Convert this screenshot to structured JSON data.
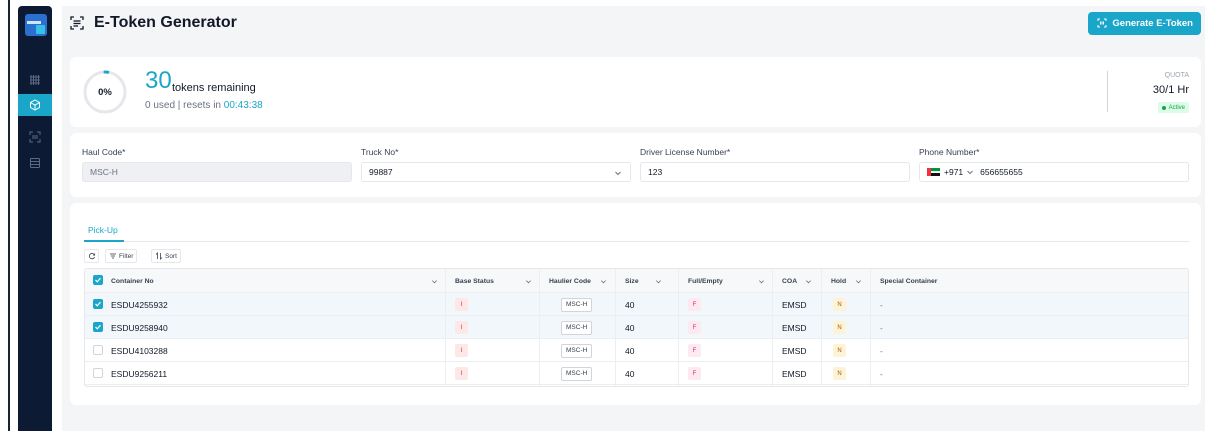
{
  "page": {
    "title": "E-Token Generator",
    "generate_button": "Generate E-Token"
  },
  "sidebar": {
    "items": [
      {
        "icon": "grid-icon",
        "active": false
      },
      {
        "icon": "cube-icon",
        "active": true
      },
      {
        "icon": "scan-icon",
        "active": false
      },
      {
        "icon": "stack-icon",
        "active": false
      }
    ]
  },
  "quota": {
    "percent_used": 0,
    "percent_label": "0%",
    "remaining_count": "30",
    "remaining_label": "tokens remaining",
    "used_text": "0 used | resets in",
    "reset_timer": "00:43:38",
    "label": "QUOTA",
    "value": "30/1 Hr",
    "status": "Active"
  },
  "form": {
    "haul_code": {
      "label": "Haul Code*",
      "value": "MSC-H"
    },
    "truck_no": {
      "label": "Truck No*",
      "value": "99887"
    },
    "driver_license": {
      "label": "Driver License Number*",
      "value": "123"
    },
    "phone": {
      "label": "Phone Number*",
      "country_code": "+971",
      "value": "656655655"
    }
  },
  "tabs": [
    {
      "label": "Pick-Up",
      "active": true
    }
  ],
  "toolbar": {
    "filter_label": "Filter",
    "sort_label": "Sort"
  },
  "table": {
    "headers": {
      "container_no": "Container No",
      "base_status": "Base Status",
      "haulier_code": "Haulier Code",
      "size": "Size",
      "full_empty": "Full/Empty",
      "coa": "COA",
      "hold": "Hold",
      "special_container": "Special Container"
    },
    "select_all_checked": true,
    "rows": [
      {
        "checked": true,
        "container_no": "ESDU4255932",
        "base_status": "I",
        "haulier_code": "MSC-H",
        "size": "40",
        "full_empty": "F",
        "coa": "EMSD",
        "hold": "N",
        "special_container": "-"
      },
      {
        "checked": true,
        "container_no": "ESDU9258940",
        "base_status": "I",
        "haulier_code": "MSC-H",
        "size": "40",
        "full_empty": "F",
        "coa": "EMSD",
        "hold": "N",
        "special_container": "-"
      },
      {
        "checked": false,
        "container_no": "ESDU4103288",
        "base_status": "I",
        "haulier_code": "MSC-H",
        "size": "40",
        "full_empty": "F",
        "coa": "EMSD",
        "hold": "N",
        "special_container": "-"
      },
      {
        "checked": false,
        "container_no": "ESDU9256211",
        "base_status": "I",
        "haulier_code": "MSC-H",
        "size": "40",
        "full_empty": "F",
        "coa": "EMSD",
        "hold": "N",
        "special_container": "-"
      }
    ]
  },
  "colors": {
    "accent": "#1aa6c9",
    "sidebar": "#0d1a33",
    "active_status": "#16a34a"
  }
}
